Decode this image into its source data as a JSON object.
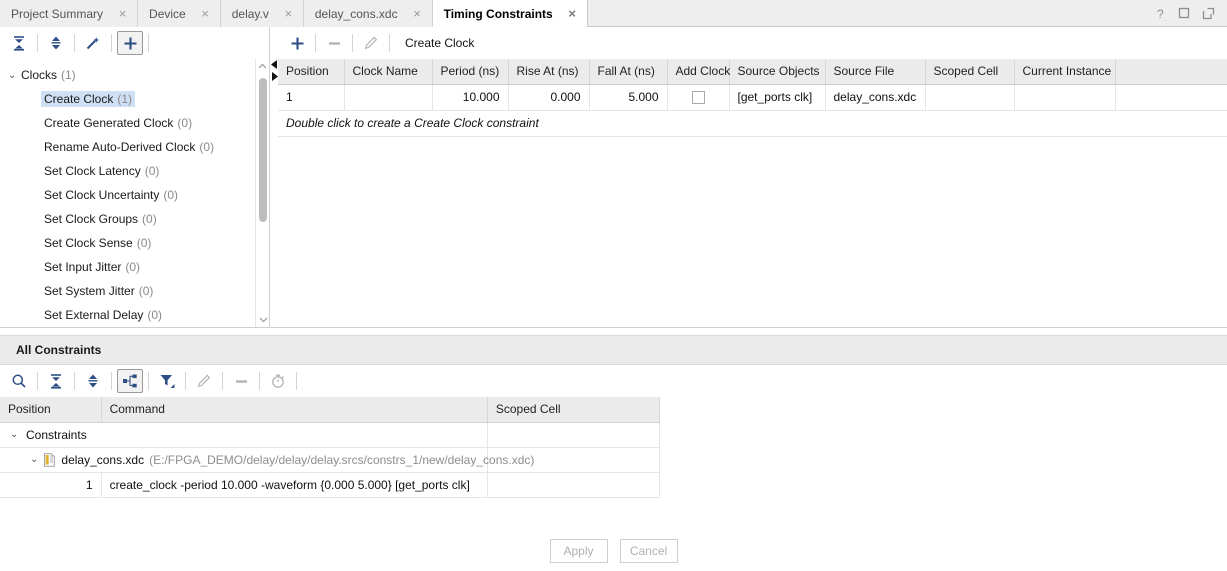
{
  "window": {
    "controls": [
      {
        "name": "help-icon",
        "glyph": "?"
      },
      {
        "name": "maximize-icon",
        "glyph": "□"
      },
      {
        "name": "float-icon",
        "glyph": "↗"
      }
    ]
  },
  "tabs": [
    {
      "label": "Project Summary",
      "active": false,
      "close": "×"
    },
    {
      "label": "Device",
      "active": false,
      "close": "×"
    },
    {
      "label": "delay.v",
      "active": false,
      "close": "×"
    },
    {
      "label": "delay_cons.xdc",
      "active": false,
      "close": "×"
    },
    {
      "label": "Timing Constraints",
      "active": true,
      "close": "×"
    }
  ],
  "left_toolbar": [
    {
      "name": "collapse-all-icon",
      "enabled": true,
      "boxed": false
    },
    {
      "name": "expand-collapse-icon",
      "enabled": true,
      "boxed": false
    },
    {
      "name": "magic-wand-icon",
      "enabled": true,
      "boxed": false
    },
    {
      "name": "add-constraint-icon",
      "enabled": true,
      "boxed": true
    }
  ],
  "tree": {
    "root": {
      "label": "Clocks",
      "count": "(1)",
      "chevron": "⌄"
    },
    "items": [
      {
        "label": "Create Clock",
        "count": "(1)",
        "selected": true
      },
      {
        "label": "Create Generated Clock",
        "count": "(0)",
        "selected": false
      },
      {
        "label": "Rename Auto-Derived Clock",
        "count": "(0)",
        "selected": false
      },
      {
        "label": "Set Clock Latency",
        "count": "(0)",
        "selected": false
      },
      {
        "label": "Set Clock Uncertainty",
        "count": "(0)",
        "selected": false
      },
      {
        "label": "Set Clock Groups",
        "count": "(0)",
        "selected": false
      },
      {
        "label": "Set Clock Sense",
        "count": "(0)",
        "selected": false
      },
      {
        "label": "Set Input Jitter",
        "count": "(0)",
        "selected": false
      },
      {
        "label": "Set System Jitter",
        "count": "(0)",
        "selected": false
      },
      {
        "label": "Set External Delay",
        "count": "(0)",
        "selected": false
      }
    ]
  },
  "right_toolbar": {
    "add_label": "add-icon",
    "remove_label": "remove-icon",
    "edit_label": "edit-pencil-icon",
    "title": "Create Clock"
  },
  "clock_grid": {
    "columns": [
      "Position",
      "Clock Name",
      "Period (ns)",
      "Rise At (ns)",
      "Fall At (ns)",
      "Add Clock",
      "Source Objects",
      "Source File",
      "Scoped Cell",
      "Current Instance"
    ],
    "rows": [
      {
        "position": "1",
        "clock_name": "",
        "period": "10.000",
        "rise_at": "0.000",
        "fall_at": "5.000",
        "add_clock": false,
        "source_objects": "[get_ports clk]",
        "source_file": "delay_cons.xdc",
        "scoped_cell": "",
        "current_instance": ""
      }
    ],
    "hint": "Double click to create a Create Clock constraint"
  },
  "all_constraints": {
    "title": "All Constraints",
    "toolbar": [
      {
        "name": "search-icon",
        "enabled": true,
        "boxed": false
      },
      {
        "name": "collapse-all-icon",
        "enabled": true,
        "boxed": false
      },
      {
        "name": "expand-collapse-icon",
        "enabled": true,
        "boxed": false
      },
      {
        "name": "hierarchy-tree-icon",
        "enabled": true,
        "boxed": true
      },
      {
        "name": "filter-icon",
        "enabled": true,
        "boxed": false
      },
      {
        "name": "edit-pencil-icon",
        "enabled": false,
        "boxed": false
      },
      {
        "name": "remove-icon",
        "enabled": false,
        "boxed": false
      },
      {
        "name": "timer-icon",
        "enabled": false,
        "boxed": false
      }
    ],
    "columns": [
      "Position",
      "Command",
      "Scoped Cell"
    ],
    "group": {
      "label": "Constraints",
      "chevron": "⌄"
    },
    "file": {
      "chevron": "⌄",
      "name": "delay_cons.xdc",
      "path": "(E:/FPGA_DEMO/delay/delay/delay.srcs/constrs_1/new/delay_cons.xdc)"
    },
    "rows": [
      {
        "position": "1",
        "command": "create_clock -period 10.000 -waveform {0.000 5.000} [get_ports clk]",
        "scoped_cell": ""
      }
    ]
  },
  "footer": {
    "apply_label": "Apply",
    "cancel_label": "Cancel"
  },
  "colors": {
    "accent_blue": "#2e4f86",
    "selection": "#cfe0f5",
    "header_grey": "#ebebeb",
    "disabled": "#b4b4b4"
  }
}
